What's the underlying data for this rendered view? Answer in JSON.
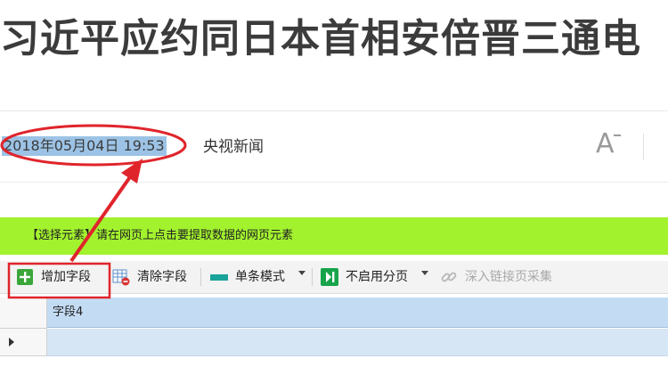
{
  "article": {
    "headline": "习近平应约同日本首相安倍晋三通电",
    "date": "2018年05月04日 19:53",
    "source": "央视新闻",
    "font_size_glyph": "A"
  },
  "hint": {
    "text": "【选择元素】请在网页上点击要提取数据的网页元素"
  },
  "toolbar": {
    "add_field": "增加字段",
    "clear_fields": "清除字段",
    "single_mode": "单条模式",
    "no_paging": "不启用分页",
    "deep_link": "深入链接页采集"
  },
  "grid": {
    "columns": [
      "字段4"
    ]
  },
  "colors": {
    "annotation_red": "#e0242b",
    "hint_green": "#a2f22e",
    "selection_blue": "#9cc3e6"
  }
}
